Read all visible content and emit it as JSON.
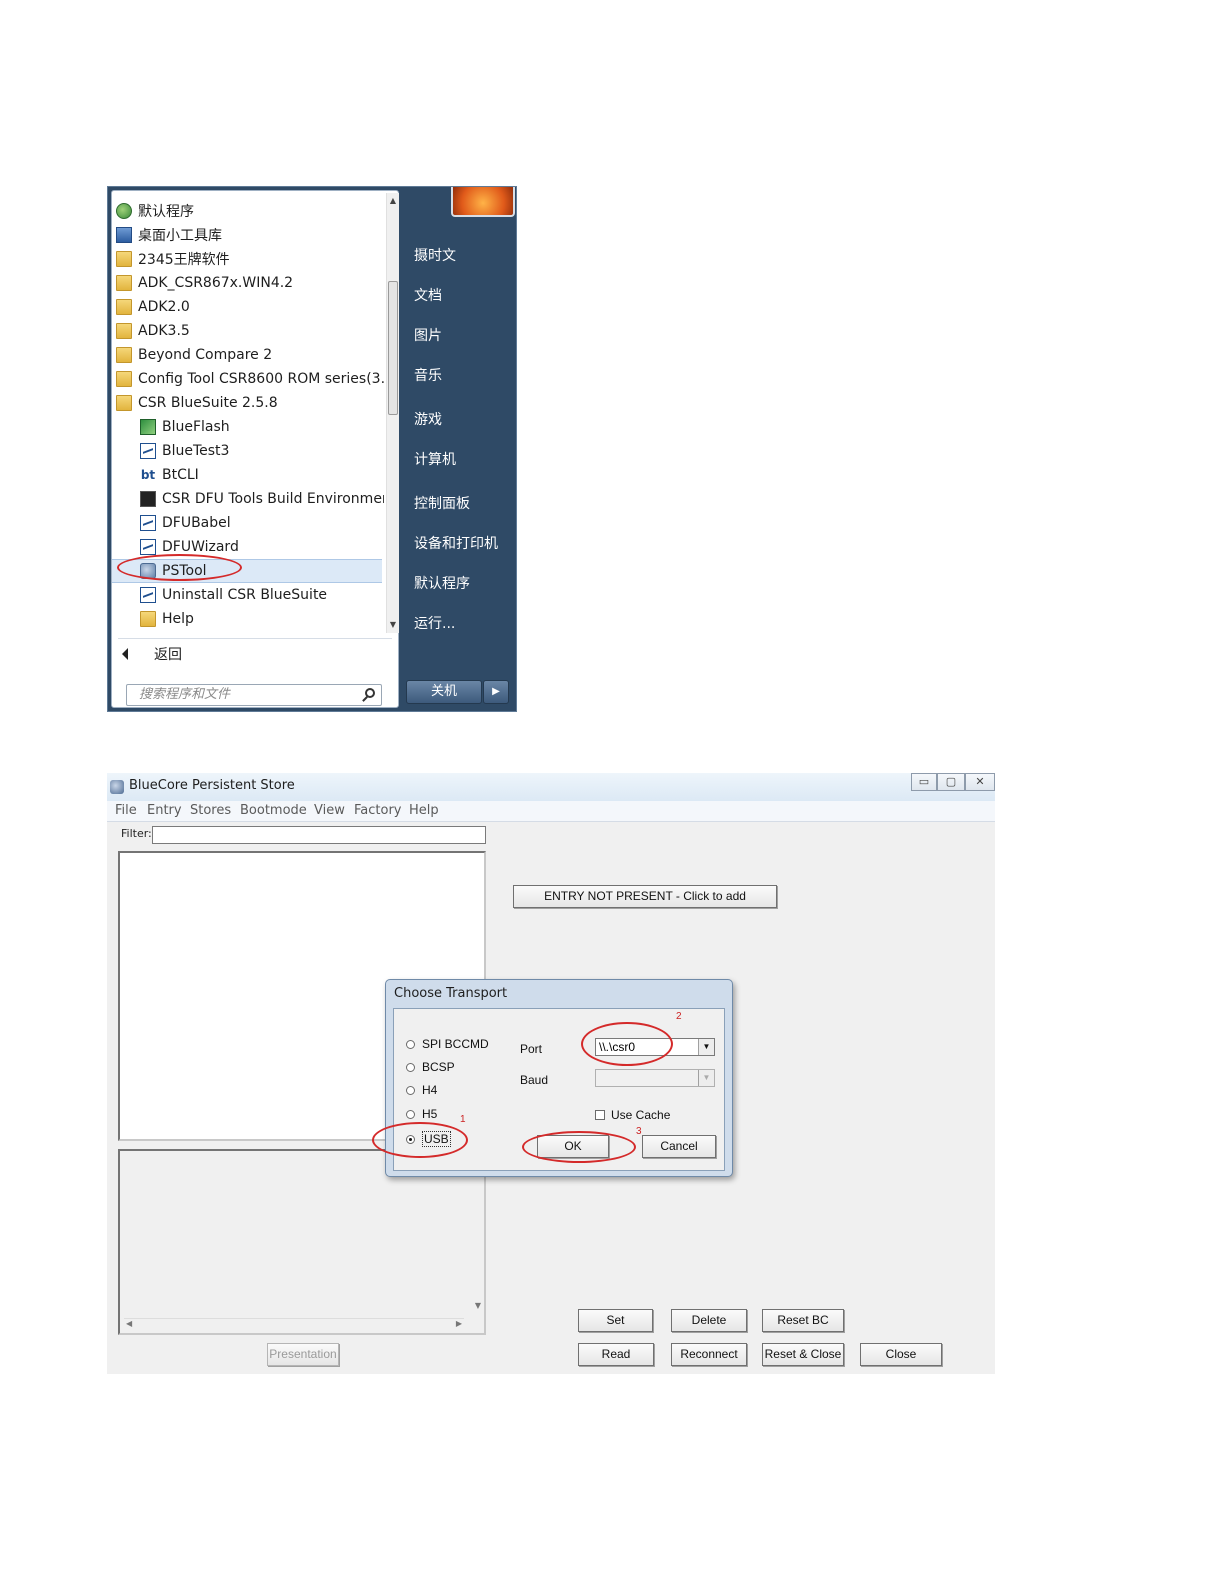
{
  "start_menu": {
    "programs": [
      {
        "label": "默认程序",
        "icon": "default-programs-icon"
      },
      {
        "label": "桌面小工具库",
        "icon": "gadget-icon"
      },
      {
        "label": "2345王牌软件",
        "icon": "folder-icon"
      },
      {
        "label": "ADK_CSR867x.WIN4.2",
        "icon": "folder-icon"
      },
      {
        "label": "ADK2.0",
        "icon": "folder-icon"
      },
      {
        "label": "ADK3.5",
        "icon": "folder-icon"
      },
      {
        "label": "Beyond Compare 2",
        "icon": "folder-icon"
      },
      {
        "label": "Config Tool CSR8600 ROM series(3.",
        "icon": "folder-icon"
      },
      {
        "label": "CSR BlueSuite 2.5.8",
        "icon": "folder-icon"
      },
      {
        "label": "BlueFlash",
        "icon": "blueflash-icon"
      },
      {
        "label": "BlueTest3",
        "icon": "csr-app-icon"
      },
      {
        "label": "BtCLI",
        "icon": "bt-icon"
      },
      {
        "label": "CSR DFU Tools Build Environmer",
        "icon": "console-icon"
      },
      {
        "label": "DFUBabel",
        "icon": "csr-app-icon"
      },
      {
        "label": "DFUWizard",
        "icon": "csr-app-icon"
      },
      {
        "label": "PSTool",
        "icon": "pstool-icon"
      },
      {
        "label": "Uninstall CSR BlueSuite",
        "icon": "csr-app-icon"
      },
      {
        "label": "Help",
        "icon": "folder-icon"
      }
    ],
    "back_label": "返回",
    "search_placeholder": "搜索程序和文件",
    "right_items": [
      "摄时文",
      "文档",
      "图片",
      "音乐",
      "游戏",
      "计算机",
      "控制面板",
      "设备和打印机",
      "默认程序",
      "运行..."
    ],
    "shutdown_label": "关机"
  },
  "pstool_window": {
    "title": "BlueCore Persistent Store",
    "menu": [
      "File",
      "Entry",
      "Stores",
      "Bootmode",
      "View",
      "Factory",
      "Help"
    ],
    "filter_label": "Filter:",
    "filter_value": "",
    "entry_button": "ENTRY NOT PRESENT - Click to add",
    "presentation_button": "Presentation",
    "buttons": {
      "set": "Set",
      "delete": "Delete",
      "reset_bc": "Reset BC",
      "read": "Read",
      "reconnect": "Reconnect",
      "reset_close": "Reset & Close",
      "close": "Close"
    }
  },
  "choose_transport": {
    "title": "Choose Transport",
    "transports": [
      {
        "label": "SPI BCCMD",
        "selected": false
      },
      {
        "label": "BCSP",
        "selected": false
      },
      {
        "label": "H4",
        "selected": false
      },
      {
        "label": "H5",
        "selected": false
      },
      {
        "label": "USB",
        "selected": true
      }
    ],
    "port_label": "Port",
    "port_value": "\\\\.\\csr0",
    "baud_label": "Baud",
    "baud_value": "",
    "use_cache_label": "Use Cache",
    "use_cache_checked": false,
    "ok_label": "OK",
    "cancel_label": "Cancel"
  },
  "annotations": {
    "mark_1": "1",
    "mark_2": "2",
    "mark_3": "3"
  },
  "colors": {
    "annotation": "#d42a2a",
    "start_menu_right": "#2f4a66"
  }
}
